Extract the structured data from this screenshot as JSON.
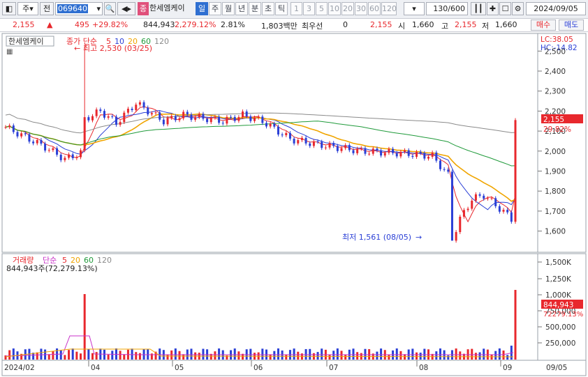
{
  "toolbar": {
    "market": "주",
    "market_prefix": "전",
    "code": "069640",
    "stock_name_tag": "종",
    "stock_name": "한세엠케이",
    "periods": [
      "일",
      "주",
      "월",
      "년",
      "분",
      "초",
      "틱"
    ],
    "active_period": "일",
    "intervals": [
      "1",
      "3",
      "5",
      "10",
      "20",
      "30",
      "60",
      "120"
    ],
    "count": "130/600",
    "date": "2024/09/05"
  },
  "info": {
    "price": "2,155",
    "change": "495",
    "change_rate": "+29.82%",
    "volume": "844,943",
    "volume_rate": "2,279.12%",
    "turnover": "2.81%",
    "amount": "1,803백만",
    "pref_label": "최우선",
    "pref_value": "0",
    "pref_price": "2,155",
    "open_label": "시",
    "open": "1,660",
    "high_label": "고",
    "high": "2,155",
    "low_label": "저",
    "low": "1,660",
    "buy_label": "매수",
    "sell_label": "매도"
  },
  "price_panel": {
    "name_tag": "한세엠케이",
    "legend_prefix": "종가 단순",
    "ma_labels": [
      "5",
      "10",
      "20",
      "60",
      "120"
    ],
    "ma_colors": [
      "#e8282d",
      "#2a3fd6",
      "#f0a500",
      "#1f9a3a",
      "#8a8a8a"
    ],
    "hc_label": "LC:38.05",
    "lc_label": "HC:-14.82",
    "max_annotation": "최고 2,530 (03/25)",
    "min_annotation": "최저 1,561 (08/05)",
    "axis_ticks": [
      "2,500",
      "2,400",
      "2,300",
      "2,200",
      "2,100",
      "2,000",
      "1,900",
      "1,800",
      "1,700",
      "1,600"
    ],
    "current_price_tag": "2,155",
    "current_rate_tag": "29.82%"
  },
  "volume_panel": {
    "legend_prefix": "거래량",
    "legend_type": "단순",
    "ma_labels": [
      "5",
      "20",
      "60",
      "120"
    ],
    "summary": "844,943주(72,279.13%)",
    "axis_ticks": [
      "1,500K",
      "1,250K",
      "1,000K",
      "750,000",
      "500,000",
      "250,000"
    ],
    "current_volume_tag": "844,943",
    "current_volume_rate": "72279.13%"
  },
  "date_axis": [
    "2024/02",
    "04",
    "05",
    "06",
    "07",
    "08",
    "09",
    "09/05"
  ]
}
